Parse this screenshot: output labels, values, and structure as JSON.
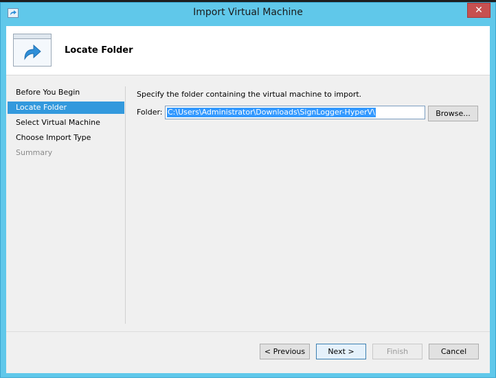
{
  "window": {
    "title": "Import Virtual Machine",
    "close_glyph": "✕"
  },
  "header": {
    "title": "Locate Folder",
    "icon": "forward-arrow-icon"
  },
  "nav": {
    "items": [
      {
        "label": "Before You Begin",
        "state": "normal"
      },
      {
        "label": "Locate Folder",
        "state": "selected"
      },
      {
        "label": "Select Virtual Machine",
        "state": "normal"
      },
      {
        "label": "Choose Import Type",
        "state": "normal"
      },
      {
        "label": "Summary",
        "state": "disabled"
      }
    ]
  },
  "content": {
    "instruction": "Specify the folder containing the virtual machine to import.",
    "folder_label": "Folder:",
    "folder_value": "C:\\Users\\Administrator\\Downloads\\SignLogger-HyperV\\",
    "browse_label": "Browse..."
  },
  "footer": {
    "previous_label": "< Previous",
    "next_label": "Next >",
    "finish_label": "Finish",
    "cancel_label": "Cancel"
  },
  "colors": {
    "titlebar": "#60c8ea",
    "selection": "#3399dd",
    "close": "#c75050"
  }
}
